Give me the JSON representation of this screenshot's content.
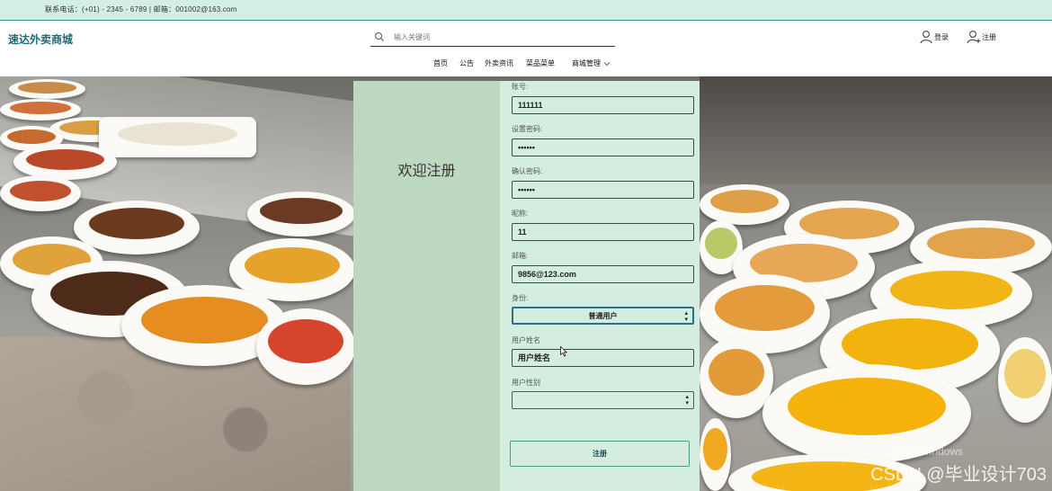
{
  "topbar": {
    "contact": "联系电话：(+01) - 2345 - 6789 | 邮箱：001002@163.com"
  },
  "header": {
    "logo": "速达外卖商城",
    "search_placeholder": "输入关键词",
    "login": "登录",
    "register": "注册"
  },
  "nav": {
    "items": [
      "首页",
      "公告",
      "外卖资讯",
      "菜品菜单"
    ],
    "dropdown": "商城管理"
  },
  "panel": {
    "welcome": "欢迎注册",
    "fields": {
      "account": {
        "label": "账号:",
        "value": "111111"
      },
      "password": {
        "label": "设置密码:",
        "value": "••••••"
      },
      "confirm": {
        "label": "确认密码:",
        "value": "••••••"
      },
      "nickname": {
        "label": "昵称:",
        "value": "11"
      },
      "email": {
        "label": "邮箱:",
        "value": "9856@123.com"
      },
      "identity": {
        "label": "身份:",
        "value": "普通用户"
      },
      "realname": {
        "label": "用户姓名",
        "value": "用户姓名"
      },
      "gender": {
        "label": "用户性别",
        "value": ""
      }
    },
    "submit": "注册"
  },
  "watermarks": {
    "csdn": "CSDN @毕业设计703",
    "windows": "激活 Windows"
  },
  "colors": {
    "topbar": "#d3efe3",
    "panel_left": "#bcd8c0",
    "panel_right": "#d3eee0",
    "accent": "#1f6b74"
  }
}
